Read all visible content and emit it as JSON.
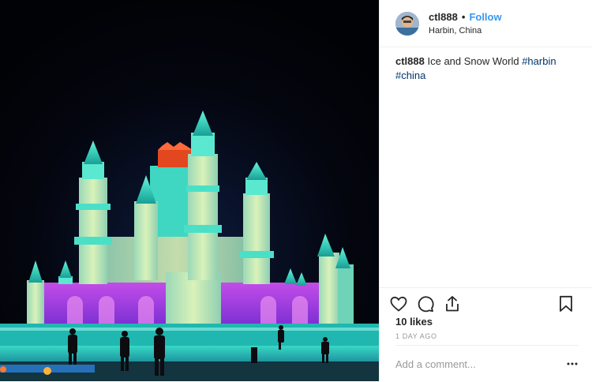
{
  "post": {
    "username": "ctl888",
    "separator": "•",
    "follow_label": "Follow",
    "location": "Harbin, China",
    "caption": {
      "username": "ctl888",
      "text": " Ice and Snow World ",
      "hashtags": [
        "#harbin",
        "#china"
      ]
    },
    "likes": "10 likes",
    "timestamp": "1 DAY AGO",
    "comment_placeholder": "Add a comment..."
  },
  "icons": {
    "like": "heart-icon",
    "comment": "comment-icon",
    "share": "share-icon",
    "save": "bookmark-icon",
    "more": "more-options-icon"
  },
  "colors": {
    "link": "#3897f0",
    "hashtag": "#003569",
    "text": "#262626",
    "muted": "#999999",
    "divider": "#efefef"
  }
}
